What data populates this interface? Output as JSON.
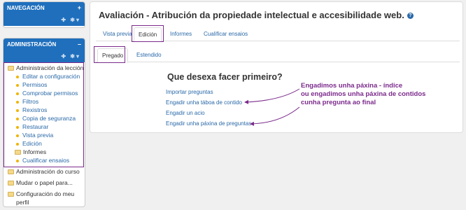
{
  "nav_block": {
    "title": "NAVEGACIÓN",
    "control": "+",
    "tools": "✚ ✱▾"
  },
  "admin_block": {
    "title": "ADMINISTRACIÓN",
    "control": "–",
    "tools": "✚ ✱▾",
    "lesson_admin": "Administración da lección",
    "lesson_items": [
      "Editar a configuración",
      "Permisos",
      "Comprobar permisos",
      "Filtros",
      "Rexistros",
      "Copia de seguranza",
      "Restaurar",
      "Vista previa",
      "Edición"
    ],
    "reports": "Informes",
    "grade_essays": "Cualificar ensaios",
    "course_admin": "Administración do curso",
    "switch_role": "Mudar o papel para...",
    "profile_settings_1": "Configuración do meu",
    "profile_settings_2": "perfil"
  },
  "main": {
    "title": "Avaliación - Atribución da propiedade intelectual e accesibilidade web.",
    "help_icon": "?",
    "tabs": [
      "Vista previa",
      "Edición",
      "Informes",
      "Cualificar ensaios"
    ],
    "subtabs": [
      "Pregado",
      "Estendido"
    ],
    "heading": "Que desexa facer primeiro?",
    "options": [
      "Importar preguntas",
      "Engadir unha táboa de contido",
      "Engadir un acio",
      "Engadir unha páxina de preguntas"
    ]
  },
  "annotation": {
    "line1": "Engadimos unha páxina - índice",
    "line2": "ou engadimos unha páxina de contidos",
    "line3": "cunha pregunta ao final"
  },
  "colors": {
    "accent": "#1f6fbd",
    "link": "#2a69a8",
    "annotation": "#7b2a8b"
  }
}
